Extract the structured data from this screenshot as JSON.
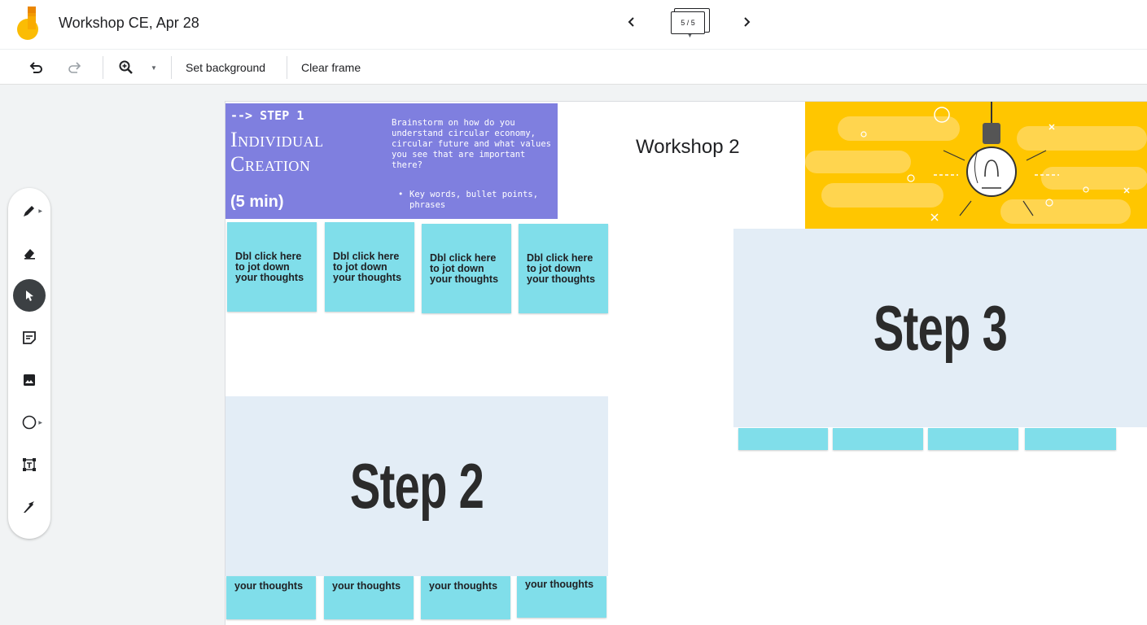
{
  "header": {
    "title": "Workshop CE, Apr 28",
    "frame_counter": "5 / 5"
  },
  "toolbar": {
    "set_background": "Set background",
    "clear_frame": "Clear frame"
  },
  "tools": [
    "pen",
    "eraser",
    "select",
    "sticky-note",
    "image",
    "circle",
    "text-box",
    "laser"
  ],
  "canvas": {
    "step1": {
      "heading": "--> STEP 1",
      "title": "Individual Creation",
      "duration": "(5 min)",
      "description": "Brainstorm on how do you understand circular economy, circular future and what values you see that are important there?",
      "bullet": "Key words, bullet points, phrases"
    },
    "sticky_text": "Dbl click here to jot down your thoughts",
    "sticky_bottom_text": "your thoughts",
    "step2_label": "Step 2",
    "step3_label": "Step 3",
    "workshop_label": "Workshop 2"
  },
  "colors": {
    "purple": "#7f7fdf",
    "sticky": "#80deea",
    "yellow": "#ffc600",
    "step_box": "#e3edf6"
  }
}
